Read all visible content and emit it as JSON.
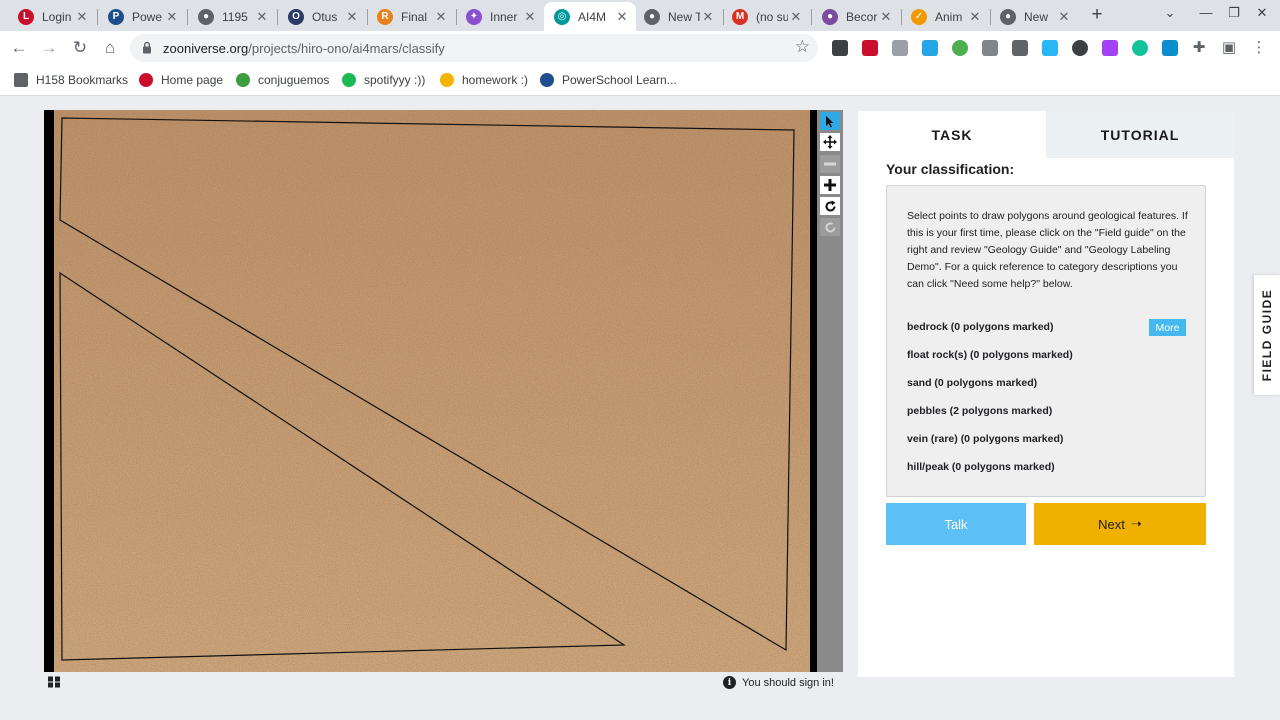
{
  "browser": {
    "tabs": [
      {
        "label": "Login",
        "icon": "login-icon",
        "color": "#c8102e",
        "glyph": "L"
      },
      {
        "label": "Powe",
        "icon": "powerschool-icon",
        "color": "#1f4e8c",
        "glyph": "P"
      },
      {
        "label": "1195",
        "icon": "globe-icon",
        "color": "#5f6368",
        "glyph": "●"
      },
      {
        "label": "Otus",
        "icon": "otus-icon",
        "color": "#2b3a67",
        "glyph": "O"
      },
      {
        "label": "Final",
        "icon": "r-icon",
        "color": "#e8821e",
        "glyph": "R"
      },
      {
        "label": "Inner",
        "icon": "inner-icon",
        "color": "#8a4fd1",
        "glyph": "✦"
      },
      {
        "label": "AI4M",
        "icon": "zooniverse-icon",
        "color": "#00979d",
        "glyph": "◎"
      },
      {
        "label": "New T",
        "icon": "globe-icon",
        "color": "#5f6368",
        "glyph": "●"
      },
      {
        "label": "(no su",
        "icon": "gmail-icon",
        "color": "#d93025",
        "glyph": "M"
      },
      {
        "label": "Becor",
        "icon": "becor-icon",
        "color": "#7b4d9e",
        "glyph": "●"
      },
      {
        "label": "Anim",
        "icon": "anim-icon",
        "color": "#f29900",
        "glyph": "✓"
      },
      {
        "label": "New",
        "icon": "globe-icon",
        "color": "#5f6368",
        "glyph": "●"
      }
    ],
    "new_tab_label": "+",
    "address": {
      "host": "zooniverse.org",
      "path": "/projects/hiro-ono/ai4mars/classify"
    },
    "bookmarks": [
      {
        "label": "H158 Bookmarks",
        "icon": "folder-icon",
        "color": "#5f6368"
      },
      {
        "label": "Home page",
        "icon": "home-page-icon",
        "color": "#c8102e"
      },
      {
        "label": "conjuguemos",
        "icon": "frog-icon",
        "color": "#3e9b3e"
      },
      {
        "label": "spotifyyy :))",
        "icon": "spotify-icon",
        "color": "#1db954"
      },
      {
        "label": "homework :)",
        "icon": "homework-icon",
        "color": "#f4b400"
      },
      {
        "label": "PowerSchool Learn...",
        "icon": "powerschool-icon",
        "color": "#1f4e8c"
      }
    ]
  },
  "classifier": {
    "tabs": {
      "task": "TASK",
      "tutorial": "TUTORIAL"
    },
    "heading": "Your classification:",
    "instructions": "Select points to draw polygons around geological features. If this is your first time, please click on the \"Field guide\" on the right and review \"Geology Guide\" and \"Geology Labeling Demo\". For a quick reference to category descriptions you can click \"Need some help?\" below.",
    "features": [
      "bedrock (0 polygons marked)",
      "float rock(s) (0 polygons marked)",
      "sand (0 polygons marked)",
      "pebbles (2 polygons marked)",
      "vein (rare) (0 polygons marked)",
      "hill/peak (0 polygons marked)"
    ],
    "more_label": "More",
    "talk_label": "Talk",
    "next_label": "Next",
    "next_arrow": "➝",
    "field_guide_label": "FIELD GUIDE",
    "signin_notice": "You should sign in!",
    "info_glyph": "i"
  },
  "colors": {
    "accent_blue": "#45b9ef",
    "talk_blue": "#5cbff6",
    "next_yellow": "#efb000",
    "terrain": "#c49a6c"
  }
}
